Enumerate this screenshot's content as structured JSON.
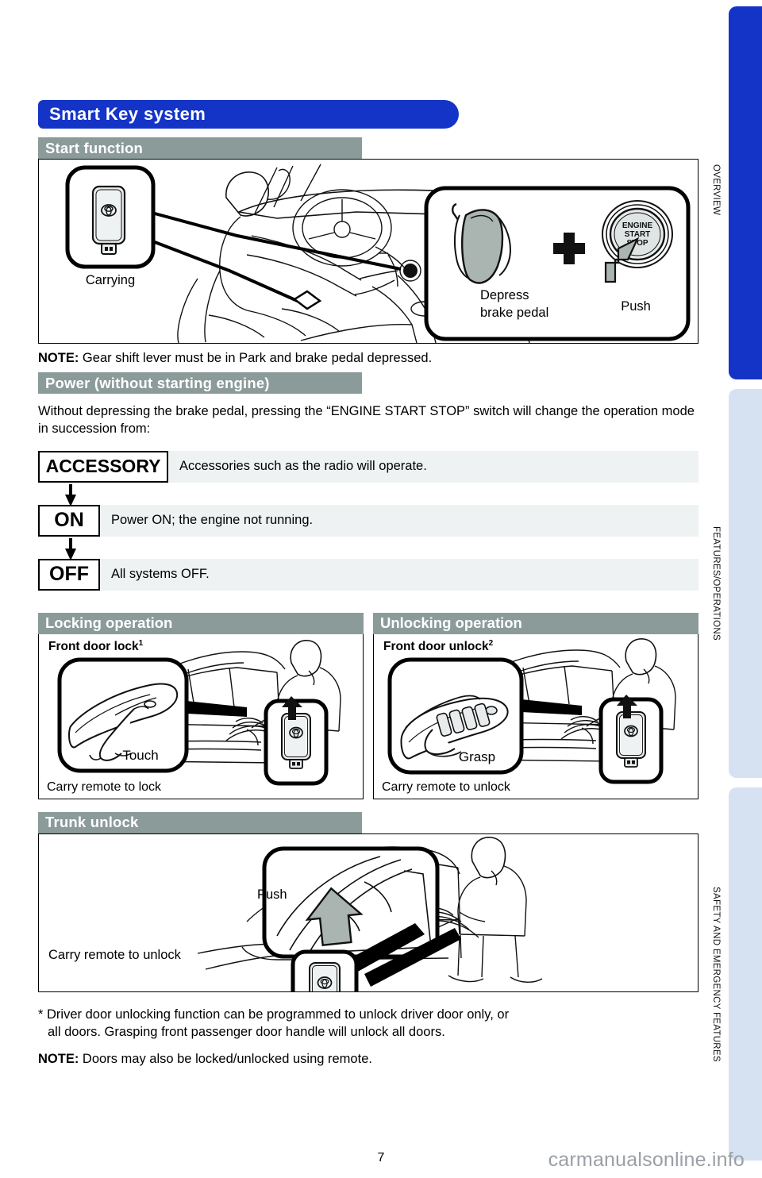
{
  "document": {
    "page_number": "7",
    "watermark": "carmanualsonline.info"
  },
  "side_tabs": [
    {
      "label": "OVERVIEW",
      "color": "#1434c8",
      "active": true
    },
    {
      "label": "FEATURES/OPERATIONS",
      "color": "#d6e2f2",
      "active": false
    },
    {
      "label": "SAFETY AND EMERGENCY FEATURES",
      "color": "#d6e2f2",
      "active": false
    }
  ],
  "main": {
    "title": "Smart Key system",
    "title_color": "#1434c8",
    "subhead_color": "#8b9b9a"
  },
  "start_function": {
    "heading": "Start function",
    "figure_labels": {
      "carrying": "Carrying",
      "depress": "Depress",
      "brake_pedal": "brake pedal",
      "push": "Push",
      "engine_line1": "ENGINE",
      "engine_line2": "START",
      "engine_line3": "STOP",
      "plus": "+"
    },
    "note_prefix": "NOTE:",
    "note_text": " Gear shift lever must be in Park and brake pedal depressed."
  },
  "power_section": {
    "heading": "Power (without starting engine)",
    "paragraph": "Without depressing the brake pedal, pressing the “ENGINE START STOP” switch will change the operation mode in succession from:",
    "modes": [
      {
        "chip": "ACCESSORY",
        "description": "Accessories such as the radio will operate."
      },
      {
        "chip": "ON",
        "description": "Power ON; the engine not running."
      },
      {
        "chip": "OFF",
        "description": "All systems OFF."
      }
    ]
  },
  "locking": {
    "heading": "Locking operation",
    "title": "Front door lock",
    "superscript": "1",
    "action_label": "Touch",
    "caption": "Carry remote to lock"
  },
  "unlocking": {
    "heading": "Unlocking operation",
    "title": "Front door unlock",
    "superscript": "2",
    "action_label": "Grasp",
    "caption": "Carry remote to unlock"
  },
  "trunk": {
    "heading": "Trunk unlock",
    "push_label": "Push",
    "caption": "Carry remote to unlock"
  },
  "footnotes": {
    "star_line1": "* Driver door unlocking function can be programmed to unlock driver door only, or",
    "star_line2": "all doors. Grasping front passenger door handle will unlock all doors.",
    "note_prefix": "NOTE:",
    "note_text": " Doors may also be locked/unlocked using remote."
  }
}
